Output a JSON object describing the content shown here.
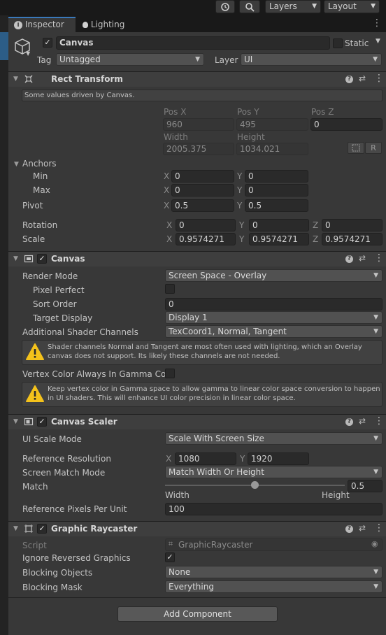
{
  "toolbar": {
    "history_icon": "history-icon",
    "search_icon": "search-icon",
    "layers_label": "Layers",
    "layout_label": "Layout"
  },
  "tabs": [
    {
      "label": "Inspector",
      "icon": "info-icon",
      "active": true
    },
    {
      "label": "Lighting",
      "icon": "bulb-icon",
      "active": false
    }
  ],
  "gameobject": {
    "name": "Canvas",
    "active": true,
    "static_label": "Static",
    "static": false,
    "tag_label": "Tag",
    "tag_value": "Untagged",
    "layer_label": "Layer",
    "layer_value": "UI"
  },
  "rect_transform": {
    "title": "Rect Transform",
    "note": "Some values driven by Canvas.",
    "pos_x_label": "Pos X",
    "pos_y_label": "Pos Y",
    "pos_z_label": "Pos Z",
    "pos_x": "960",
    "pos_y": "495",
    "pos_z": "0",
    "width_label": "Width",
    "height_label": "Height",
    "width": "2005.375",
    "height": "1034.021",
    "raw_button": "R",
    "anchors_label": "Anchors",
    "min_label": "Min",
    "max_label": "Max",
    "min_x": "0",
    "min_y": "0",
    "max_x": "0",
    "max_y": "0",
    "pivot_label": "Pivot",
    "pivot_x": "0.5",
    "pivot_y": "0.5",
    "rotation_label": "Rotation",
    "rot_x": "0",
    "rot_y": "0",
    "rot_z": "0",
    "scale_label": "Scale",
    "scale_x": "0.9574271",
    "scale_y": "0.9574271",
    "scale_z": "0.9574271"
  },
  "canvas": {
    "title": "Canvas",
    "render_mode_label": "Render Mode",
    "render_mode": "Screen Space - Overlay",
    "pixel_perfect_label": "Pixel Perfect",
    "sort_order_label": "Sort Order",
    "sort_order": "0",
    "target_display_label": "Target Display",
    "target_display": "Display 1",
    "shader_channels_label": "Additional Shader Channels",
    "shader_channels": "TexCoord1, Normal, Tangent",
    "warning1": "Shader channels Normal and Tangent are most often used with lighting, which an Overlay canvas does not support. Its likely these channels are not needed.",
    "vertex_color_label": "Vertex Color Always In Gamma Colo",
    "warning2": "Keep vertex color in Gamma space to allow gamma to linear color space conversion to happen in UI shaders. This will enhance UI color precision in linear color space."
  },
  "canvas_scaler": {
    "title": "Canvas Scaler",
    "ui_scale_mode_label": "UI Scale Mode",
    "ui_scale_mode": "Scale With Screen Size",
    "ref_res_label": "Reference Resolution",
    "ref_x": "1080",
    "ref_y": "1920",
    "match_mode_label": "Screen Match Mode",
    "match_mode": "Match Width Or Height",
    "match_label": "Match",
    "match_value": "0.5",
    "width_label": "Width",
    "height_label": "Height",
    "ppu_label": "Reference Pixels Per Unit",
    "ppu": "100"
  },
  "graphic_raycaster": {
    "title": "Graphic Raycaster",
    "script_label": "Script",
    "script_value": "GraphicRaycaster",
    "ignore_reversed_label": "Ignore Reversed Graphics",
    "blocking_objects_label": "Blocking Objects",
    "blocking_objects": "None",
    "blocking_mask_label": "Blocking Mask",
    "blocking_mask": "Everything"
  },
  "add_component_label": "Add Component",
  "colors": {
    "panel_bg": "#383838",
    "accent": "#3a79bb",
    "warning": "#f4c21b"
  }
}
